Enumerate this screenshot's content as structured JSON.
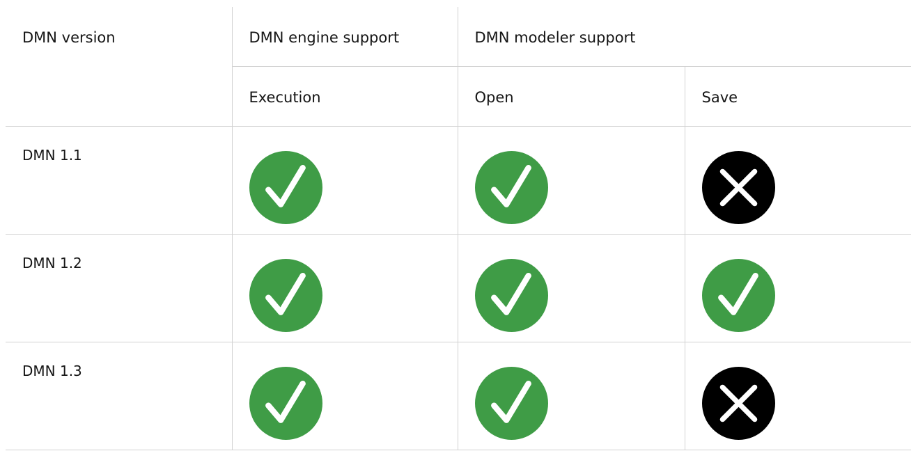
{
  "table": {
    "headers": {
      "version": "DMN version",
      "engine_support": "DMN engine support",
      "modeler_support": "DMN modeler support",
      "execution": "Execution",
      "open": "Open",
      "save": "Save"
    },
    "rows": [
      {
        "version": "DMN 1.1",
        "execution": "supported",
        "open": "supported",
        "save": "not-supported"
      },
      {
        "version": "DMN 1.2",
        "execution": "supported",
        "open": "supported",
        "save": "supported"
      },
      {
        "version": "DMN 1.3",
        "execution": "supported",
        "open": "supported",
        "save": "not-supported"
      }
    ]
  },
  "icons": {
    "supported": "check-circle-icon",
    "not_supported": "x-circle-icon"
  },
  "colors": {
    "check_fill": "#3f9c46",
    "x_fill": "#000000",
    "mark": "#ffffff",
    "border": "#d2d2d2",
    "text": "#151515"
  }
}
